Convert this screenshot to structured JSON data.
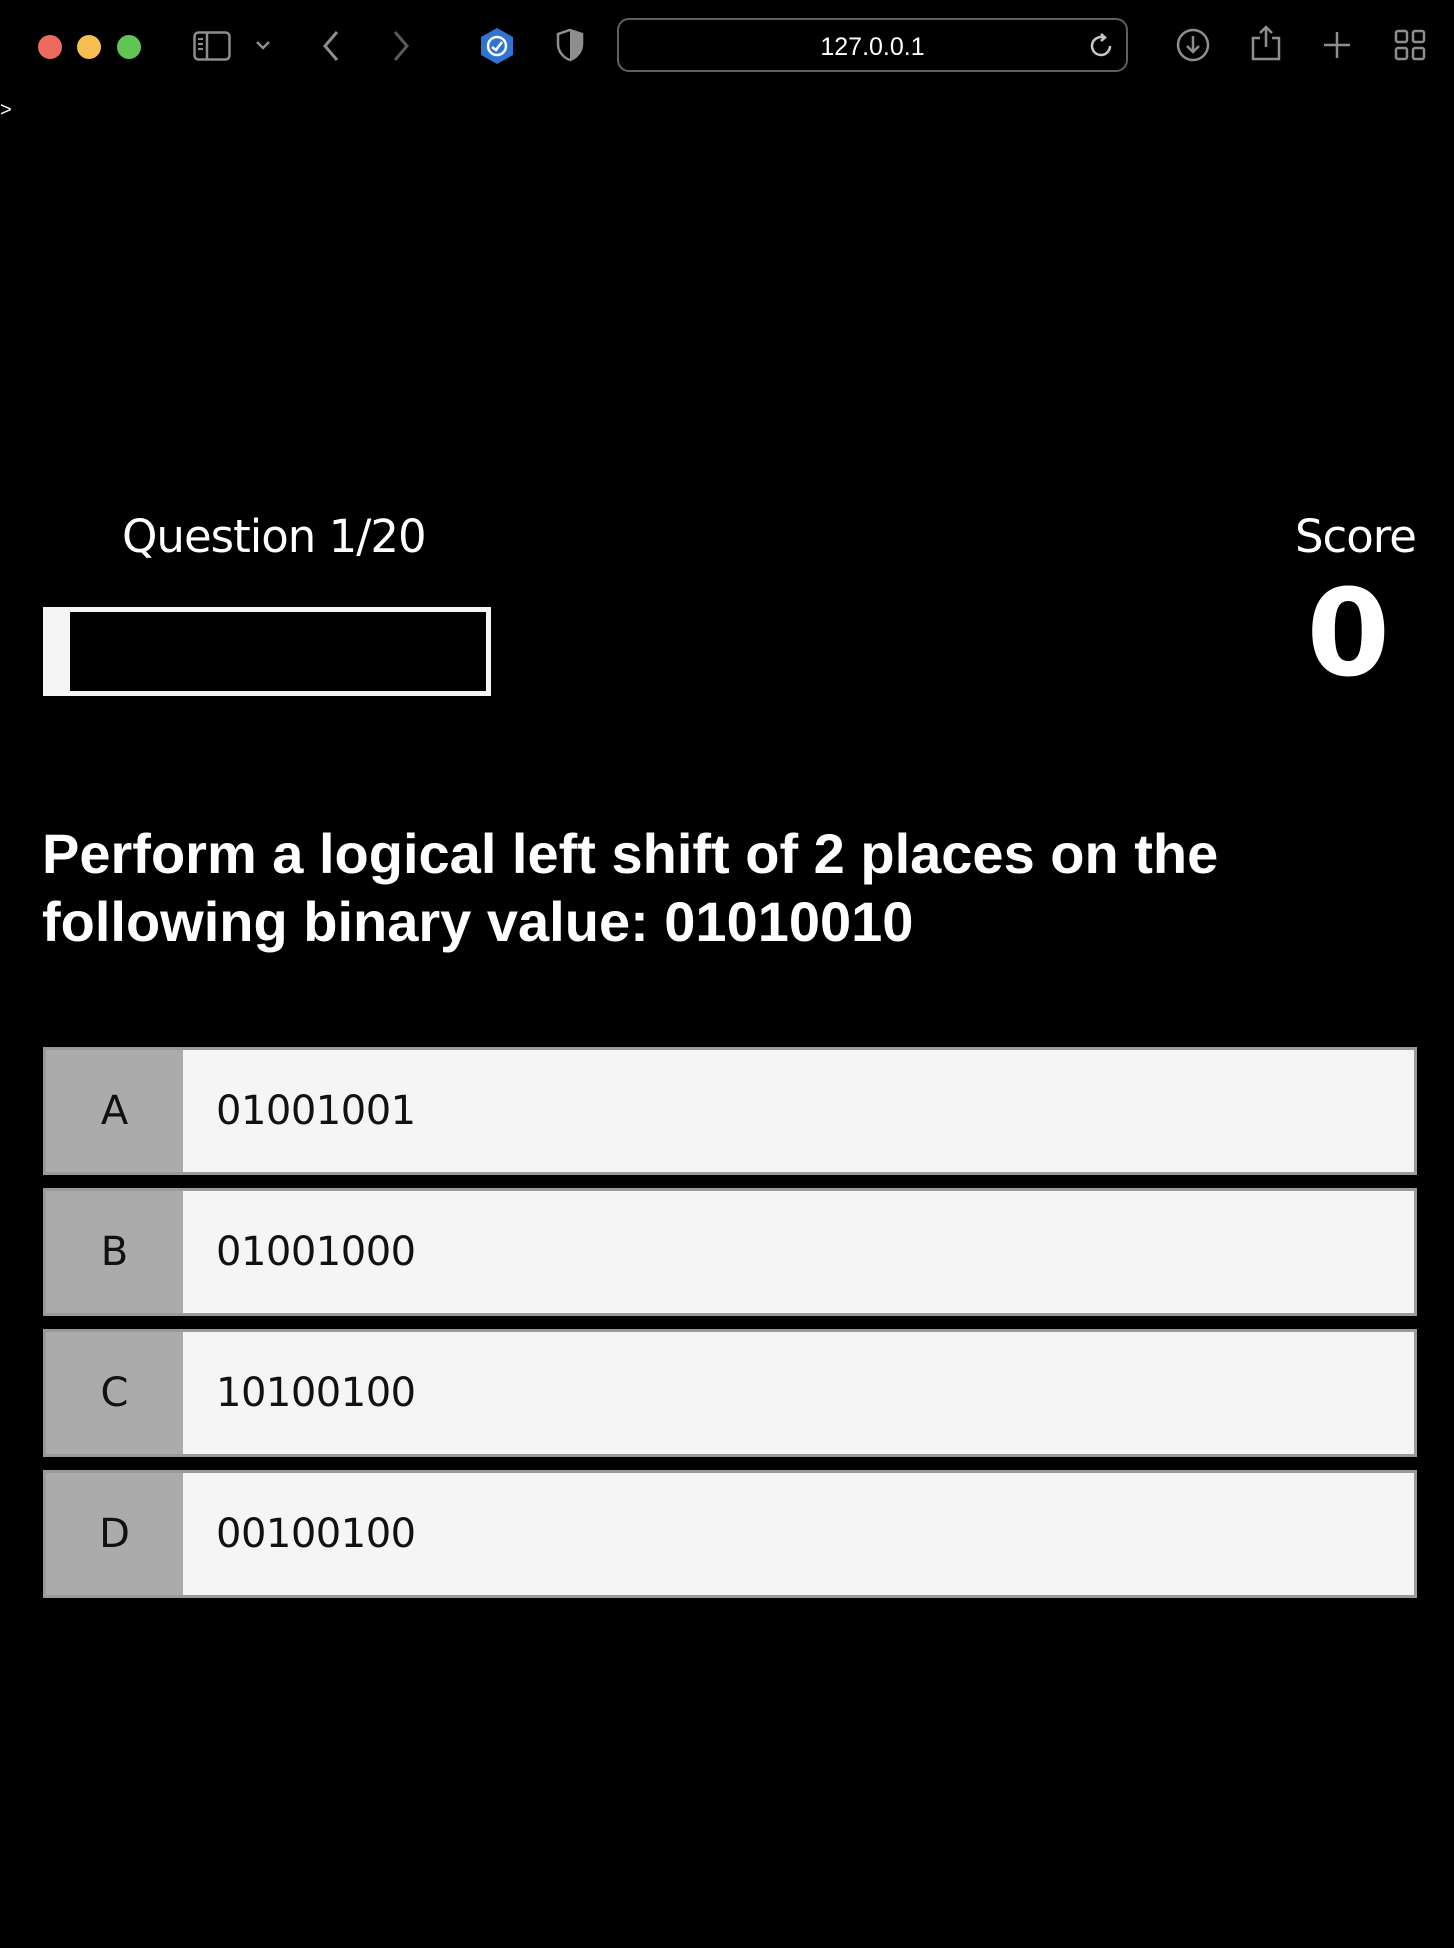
{
  "browser": {
    "url": "127.0.0.1",
    "icons": [
      "sidebar-icon",
      "chevron-down-icon",
      "back-icon",
      "forward-icon",
      "shield-extension-icon",
      "privacy-shield-icon",
      "reload-icon",
      "download-icon",
      "share-icon",
      "new-tab-icon",
      "tab-overview-icon"
    ],
    "corner_glyph": ">"
  },
  "quiz": {
    "question_counter": "Question 1/20",
    "progress_fraction": 0.05,
    "score_label": "Score",
    "score_value": "0",
    "question": "Perform a logical left shift of 2 places on the following binary value: 01010010",
    "answers": [
      {
        "letter": "A",
        "text": "01001001"
      },
      {
        "letter": "B",
        "text": "01001000"
      },
      {
        "letter": "C",
        "text": "10100100"
      },
      {
        "letter": "D",
        "text": "00100100"
      }
    ]
  },
  "colors": {
    "background": "#000000",
    "answer_bg": "#f5f5f5",
    "letter_bg": "#ababab",
    "progress": "#f5f5f5"
  }
}
